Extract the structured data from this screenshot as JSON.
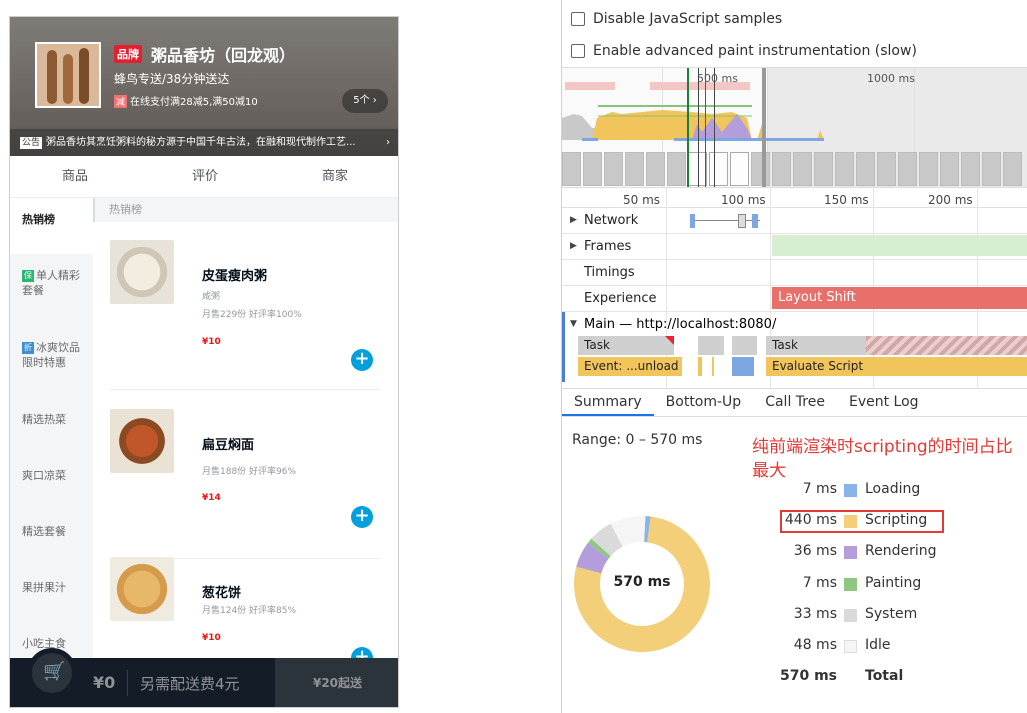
{
  "shop": {
    "brand_tag": "品牌",
    "name": "粥品香坊（回龙观）",
    "delivery": "蜂鸟专送/38分钟送达",
    "promo_tag": "减",
    "promo_text": "在线支付满28减5,满50减10",
    "promo_count": "5个 ›",
    "notice_tag": "公告",
    "notice_text": "粥品香坊其烹饪粥料的秘方源于中国千年古法，在融和现代制作工艺...",
    "notice_arrow": "›"
  },
  "tabs": [
    "商品",
    "评价",
    "商家"
  ],
  "sidebar": [
    {
      "label": "热销榜",
      "icon": "",
      "active": true
    },
    {
      "label": "单人精彩套餐",
      "icon": "保"
    },
    {
      "label": "冰爽饮品限时特惠",
      "icon": "折"
    },
    {
      "label": "精选热菜"
    },
    {
      "label": "爽口凉菜"
    },
    {
      "label": "精选套餐"
    },
    {
      "label": "果拼果汁"
    },
    {
      "label": "小吃主食"
    }
  ],
  "category_title": "热销榜",
  "foods": [
    {
      "name": "皮蛋瘦肉粥",
      "desc": "咸粥",
      "sales": "月售229份 好评率100%",
      "price": "¥10"
    },
    {
      "name": "扁豆焖面",
      "desc": "",
      "sales": "月售188份 好评率96%",
      "price": "¥14"
    },
    {
      "name": "葱花饼",
      "desc": "",
      "sales": "月售124份 好评率85%",
      "price": "¥10"
    }
  ],
  "add_label": "+",
  "cart": {
    "icon": "🛒",
    "price": "¥0",
    "tip": "另需配送费4元",
    "pay": "¥20起送"
  },
  "devtools": {
    "option_js_samples": "Disable JavaScript samples",
    "option_paint": "Enable advanced paint instrumentation (slow)",
    "overview_labels": [
      "500 ms",
      "1000 ms"
    ],
    "ruler_labels": [
      "50 ms",
      "100 ms",
      "150 ms",
      "200 ms"
    ],
    "tracks": {
      "network": "Network",
      "frames": "Frames",
      "timings": "Timings",
      "experience": "Experience",
      "layout_shift": "Layout Shift",
      "main": "Main — http://localhost:8080/"
    },
    "tasks": {
      "task1": "Task",
      "task2": "Task",
      "event": "Event: ...unload",
      "evaluate": "Evaluate Script"
    },
    "bottom_tabs": [
      "Summary",
      "Bottom-Up",
      "Call Tree",
      "Event Log"
    ],
    "range": "Range: 0 – 570 ms",
    "donut_center": "570 ms",
    "annotation": "纯前端渲染时scripting的时间占比最大",
    "legend": [
      {
        "value": "7 ms",
        "name": "Loading",
        "color": "#8ab4e8",
        "ms": 7
      },
      {
        "value": "440 ms",
        "name": "Scripting",
        "color": "#f2cf78",
        "ms": 440
      },
      {
        "value": "36 ms",
        "name": "Rendering",
        "color": "#b39ddb",
        "ms": 36
      },
      {
        "value": "7 ms",
        "name": "Painting",
        "color": "#8fc780",
        "ms": 7
      },
      {
        "value": "33 ms",
        "name": "System",
        "color": "#dadada",
        "ms": 33
      },
      {
        "value": "48 ms",
        "name": "Idle",
        "color": "#f5f5f5",
        "ms": 48
      }
    ],
    "total": {
      "value": "570 ms",
      "name": "Total"
    }
  }
}
